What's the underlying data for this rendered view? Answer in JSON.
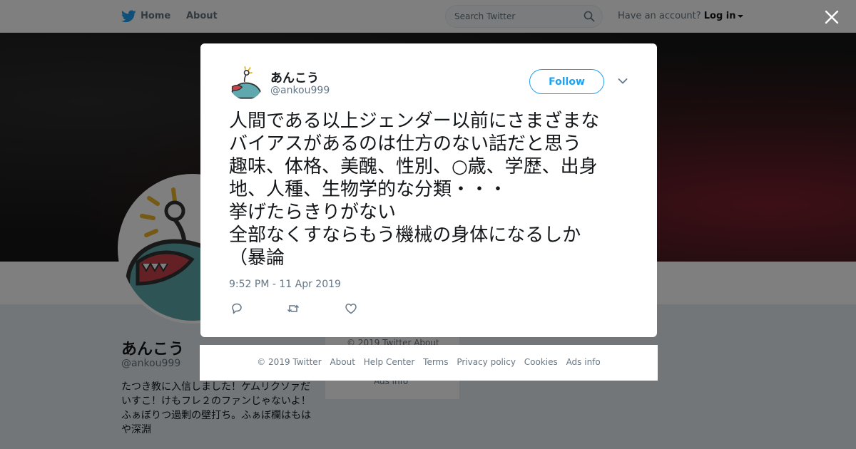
{
  "nav": {
    "home": "Home",
    "about": "About",
    "search_placeholder": "Search Twitter",
    "have_account": "Have an account?",
    "login": "Log in"
  },
  "profile": {
    "name": "あんこう",
    "handle": "@ankou999",
    "bio": "たつき教に入信しました！ケムリクソァだいすこ！けもフレ２のファンじゃないよ！ ふぁぼりつ過剰の壁打ち。ふぁぼ欄はもはや深淵",
    "footer_partial": "© 2019 Twitter   About",
    "ads_info": "Ads info"
  },
  "tweet": {
    "author_name": "あんこう",
    "author_handle": "@ankou999",
    "follow_label": "Follow",
    "lines": [
      "人間である以上ジェンダー以前にさまざまな",
      "バイアスがあるのは仕方のない話だと思う",
      "趣味、体格、美醜、性別、○歳、学歴、出身",
      "地、人種、生物学的な分類・・・",
      "挙げたらきりがない",
      "全部なくすならもう機械の身体になるしか",
      "（暴論"
    ],
    "timestamp": "9:52 PM - 11 Apr 2019",
    "icons": [
      "reply-icon",
      "retweet-icon",
      "like-icon"
    ]
  },
  "footer": {
    "links": [
      "© 2019 Twitter",
      "About",
      "Help Center",
      "Terms",
      "Privacy policy",
      "Cookies",
      "Ads info"
    ]
  },
  "colors": {
    "accent": "#1da1f2",
    "text": "#14171a",
    "muted": "#657786",
    "overlay": "rgba(0,0,0,0.5)"
  }
}
